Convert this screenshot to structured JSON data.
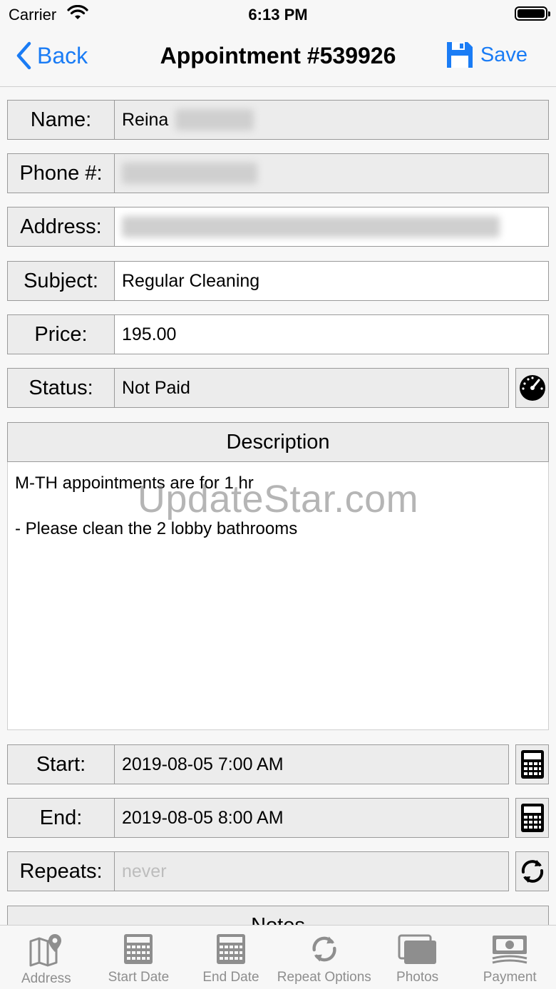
{
  "status_bar": {
    "carrier": "Carrier",
    "time": "6:13 PM"
  },
  "nav": {
    "back_label": "Back",
    "title": "Appointment #539926",
    "save_label": "Save",
    "accent_color": "#1a7cf5"
  },
  "fields": {
    "name": {
      "label": "Name:",
      "value": "Reina"
    },
    "phone": {
      "label": "Phone #:"
    },
    "address": {
      "label": "Address:"
    },
    "subject": {
      "label": "Subject:",
      "value": "Regular Cleaning"
    },
    "price": {
      "label": "Price:",
      "value": "195.00"
    },
    "status": {
      "label": "Status:",
      "value": "Not Paid"
    },
    "start": {
      "label": "Start:",
      "value": "2019-08-05 7:00 AM"
    },
    "end": {
      "label": "End:",
      "value": "2019-08-05 8:00 AM"
    },
    "repeats": {
      "label": "Repeats:",
      "placeholder": "never"
    }
  },
  "description": {
    "header": "Description",
    "text": "M-TH appointments are for 1 hr\n\n- Please clean the 2 lobby bathrooms"
  },
  "notes": {
    "header": "Notes"
  },
  "watermark": "UpdateStar.com",
  "tabs": [
    {
      "label": "Address",
      "icon": "map-pin-icon"
    },
    {
      "label": "Start Date",
      "icon": "calculator-icon"
    },
    {
      "label": "End Date",
      "icon": "calculator-icon"
    },
    {
      "label": "Repeat Options",
      "icon": "repeat-icon"
    },
    {
      "label": "Photos",
      "icon": "photos-icon"
    },
    {
      "label": "Payment",
      "icon": "money-icon"
    }
  ]
}
